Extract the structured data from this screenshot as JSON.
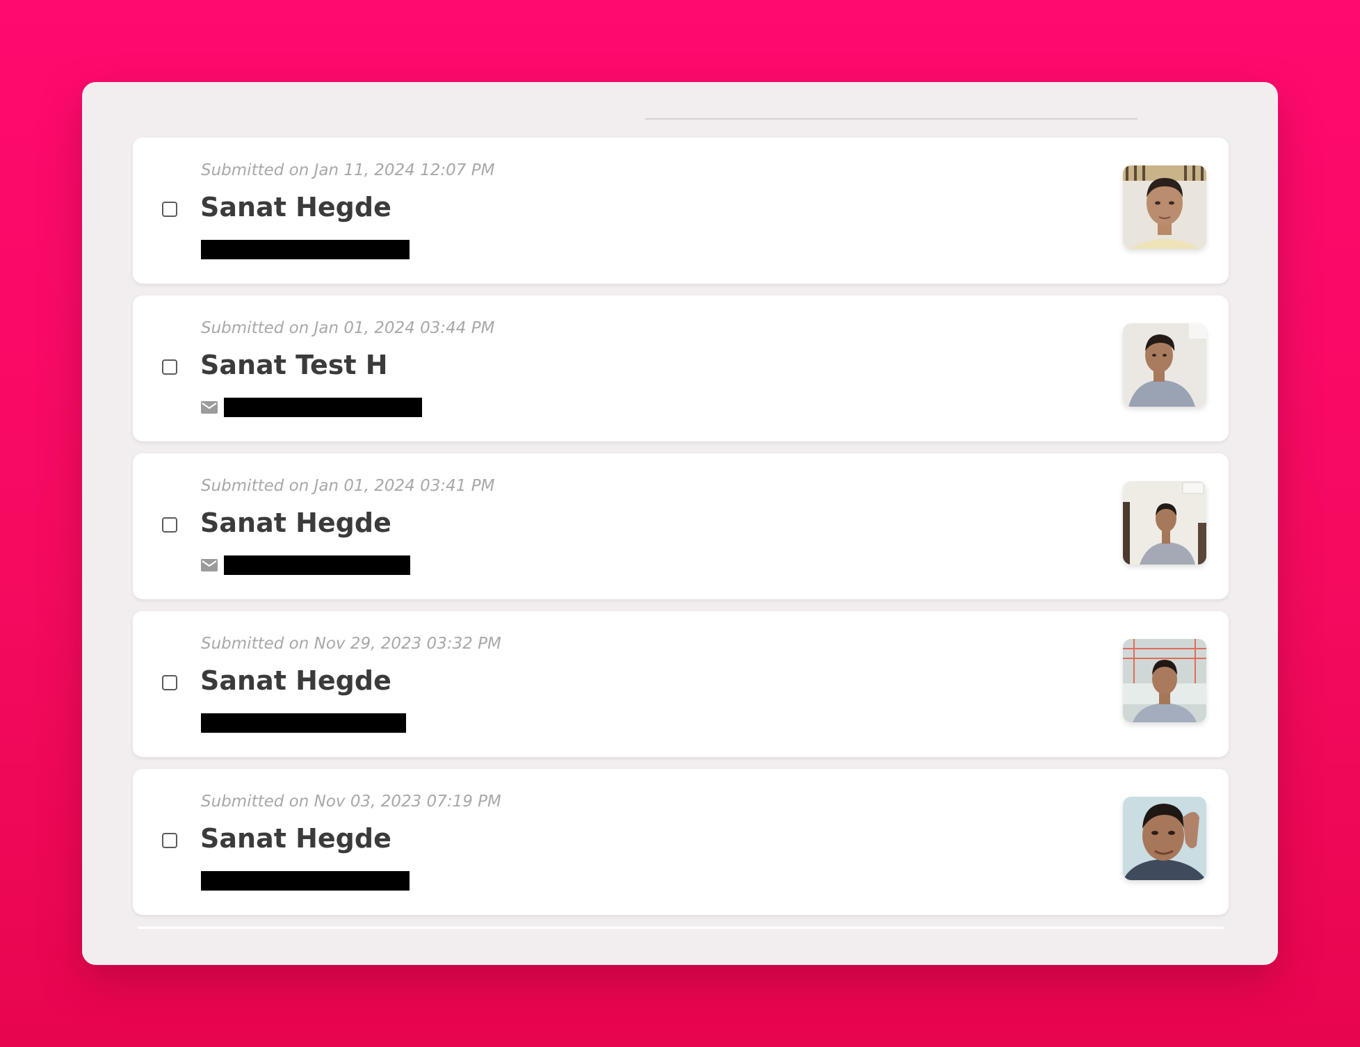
{
  "submissions": [
    {
      "submitted": "Submitted on Jan 11, 2024 12:07 PM",
      "name": "Sanat Hegde",
      "contact_icon": "none",
      "avatar_bg": "#e9e4dc",
      "avatar_shirt": "#efe3b8"
    },
    {
      "submitted": "Submitted on Jan 01, 2024 03:44 PM",
      "name": "Sanat Test H",
      "contact_icon": "mail-icon",
      "avatar_bg": "#ebe8e4",
      "avatar_shirt": "#9aa3b4"
    },
    {
      "submitted": "Submitted on Jan 01, 2024 03:41 PM",
      "name": "Sanat Hegde",
      "contact_icon": "mail-icon",
      "avatar_bg": "#efece6",
      "avatar_shirt": "#a4a9b5"
    },
    {
      "submitted": "Submitted on Nov 29, 2023 03:32 PM",
      "name": "Sanat Hegde",
      "contact_icon": "none",
      "avatar_bg": "#cfd8d6",
      "avatar_shirt": "#a3adbd"
    },
    {
      "submitted": "Submitted on Nov 03, 2023 07:19 PM",
      "name": "Sanat Hegde",
      "contact_icon": "none",
      "avatar_bg": "#c9dde2",
      "avatar_shirt": "#3f4b5c"
    }
  ]
}
